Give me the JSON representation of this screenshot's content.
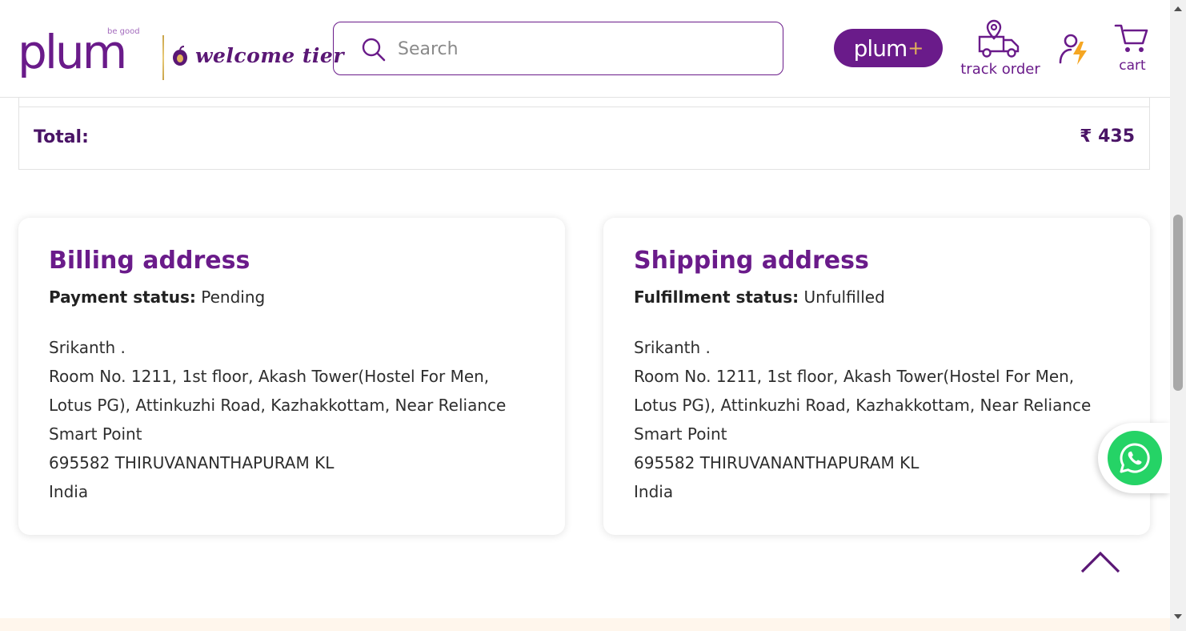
{
  "header": {
    "logo_text": "plum",
    "logo_tagline": "be good",
    "tier_label": "welcome tier",
    "search": {
      "placeholder": "Search",
      "value": ""
    },
    "plum_plus_label": "plum",
    "plum_plus_suffix": "+",
    "track_order_label": "track order",
    "cart_label": "cart"
  },
  "order_summary": {
    "total_label": "Total:",
    "total_value": "₹ 435"
  },
  "billing": {
    "title": "Billing address",
    "status_key": "Payment status:",
    "status_value": "Pending",
    "address_lines": [
      "Srikanth .",
      "Room No. 1211, 1st floor, Akash Tower(Hostel For Men,",
      "Lotus PG), Attinkuzhi Road, Kazhakkottam, Near Reliance",
      "Smart Point",
      "695582 THIRUVANANTHAPURAM KL",
      "India"
    ]
  },
  "shipping": {
    "title": "Shipping address",
    "status_key": "Fulfillment status:",
    "status_value": "Unfulfilled",
    "address_lines": [
      "Srikanth .",
      "Room No. 1211, 1st floor, Akash Tower(Hostel For Men,",
      "Lotus PG), Attinkuzhi Road, Kazhakkottam, Near Reliance",
      "Smart Point",
      "695582 THIRUVANANTHAPURAM KL",
      "India"
    ]
  },
  "icons": {
    "search": "search-icon",
    "track": "delivery-truck-icon",
    "account": "account-icon",
    "cart": "cart-icon",
    "whatsapp": "whatsapp-icon",
    "back_to_top": "chevron-up-icon"
  },
  "colors": {
    "brand_purple": "#6a1b8a",
    "gold_accent": "#e3b35a",
    "whatsapp_green": "#25d366",
    "footer_tint": "#fff6ec"
  }
}
